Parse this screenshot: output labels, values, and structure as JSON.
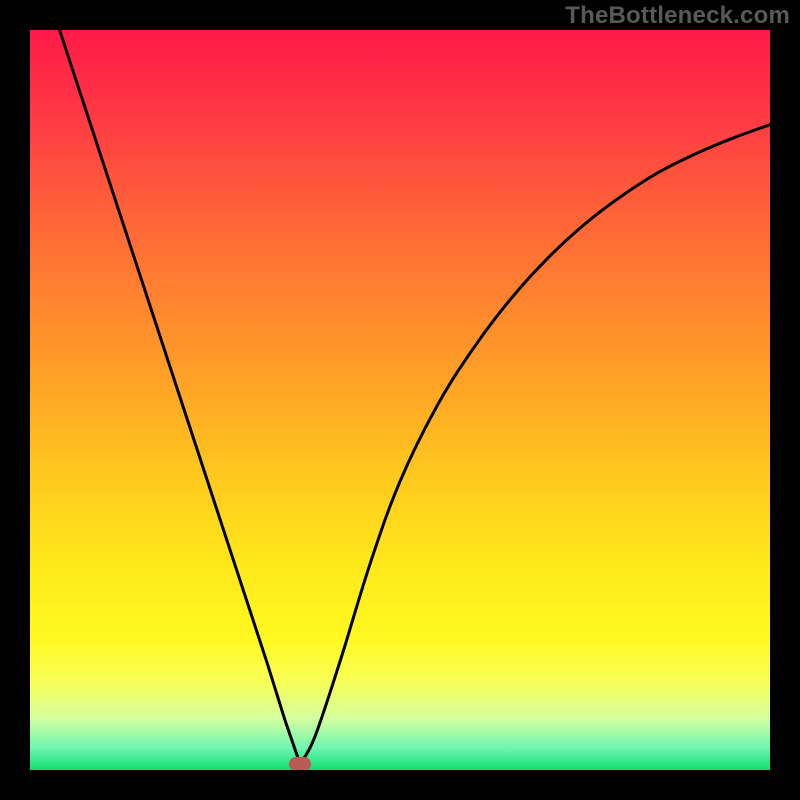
{
  "watermark": "TheBottleneck.com",
  "colors": {
    "frame": "#000000",
    "gradient_stops": [
      {
        "offset": 0.0,
        "color": "#ff1a48"
      },
      {
        "offset": 0.1,
        "color": "#ff3445"
      },
      {
        "offset": 0.22,
        "color": "#ff5a3a"
      },
      {
        "offset": 0.35,
        "color": "#ff8030"
      },
      {
        "offset": 0.48,
        "color": "#ffa426"
      },
      {
        "offset": 0.6,
        "color": "#ffc81e"
      },
      {
        "offset": 0.72,
        "color": "#ffe81a"
      },
      {
        "offset": 0.82,
        "color": "#fff820"
      },
      {
        "offset": 0.88,
        "color": "#f8ff55"
      },
      {
        "offset": 0.93,
        "color": "#d6ffa0"
      },
      {
        "offset": 0.97,
        "color": "#70f5b0"
      },
      {
        "offset": 1.0,
        "color": "#10e070"
      }
    ],
    "curve": "#000000",
    "marker": "#bb5a55"
  },
  "chart_data": {
    "type": "line",
    "title": "",
    "xlabel": "",
    "ylabel": "",
    "xlim": [
      0,
      1
    ],
    "ylim": [
      0,
      1
    ],
    "vertex_x": 0.365,
    "series": [
      {
        "name": "bottleneck_curve",
        "x": [
          0.04,
          0.08,
          0.12,
          0.16,
          0.2,
          0.24,
          0.28,
          0.32,
          0.345,
          0.365,
          0.385,
          0.42,
          0.46,
          0.5,
          0.55,
          0.6,
          0.65,
          0.7,
          0.75,
          0.8,
          0.85,
          0.9,
          0.95,
          1.0
        ],
        "y": [
          1.0,
          0.878,
          0.756,
          0.634,
          0.512,
          0.39,
          0.268,
          0.146,
          0.066,
          0.008,
          0.045,
          0.15,
          0.28,
          0.39,
          0.492,
          0.571,
          0.637,
          0.692,
          0.738,
          0.776,
          0.808,
          0.833,
          0.854,
          0.872
        ]
      }
    ],
    "marker": {
      "x": 0.365,
      "y": 0.008
    }
  }
}
